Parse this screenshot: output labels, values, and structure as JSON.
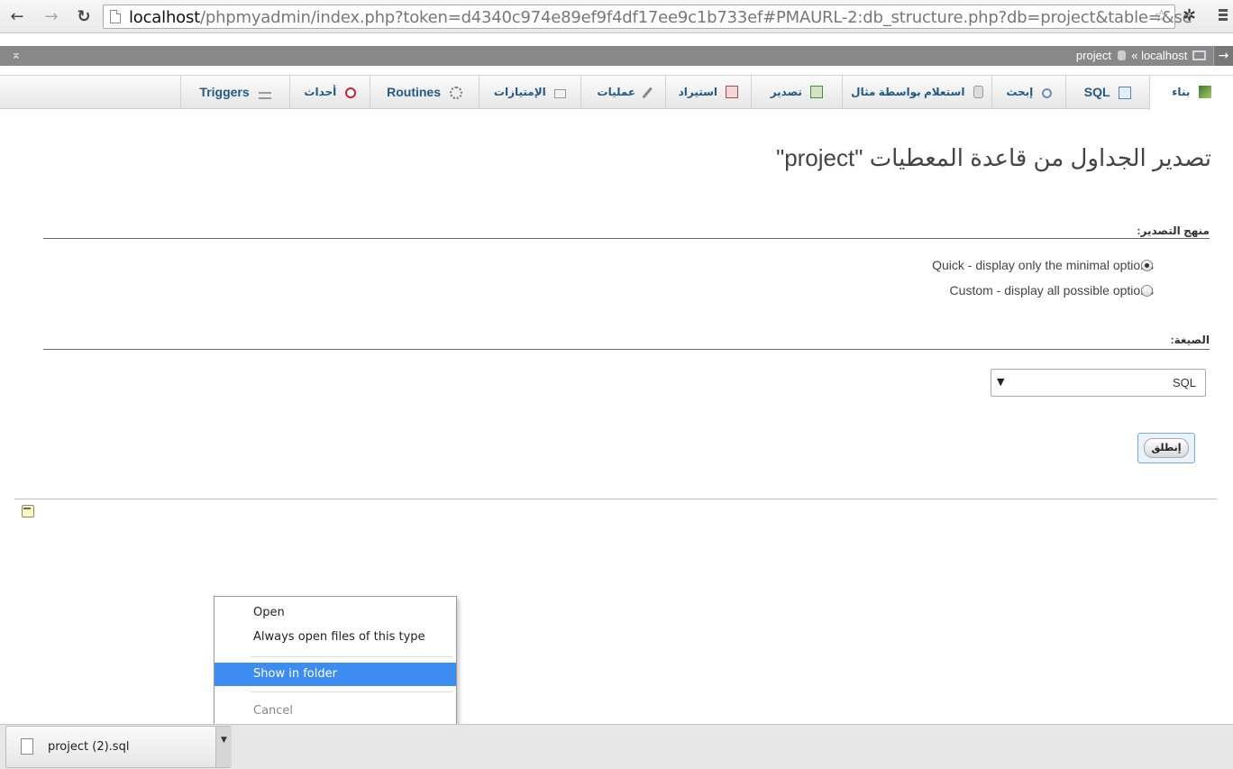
{
  "browser": {
    "url_host": "localhost",
    "url_rest": "/phpmyadmin/index.php?token=d4340c974e89ef9f4df17ee9c1b733ef#PMAURL-2:db_structure.php?db=project&table=&se"
  },
  "topbar": {
    "breadcrumb_db": "project",
    "breadcrumb_sep": "«",
    "breadcrumb_server": "localhost"
  },
  "tabs": [
    {
      "label": "بناء",
      "icon": "structure-icon",
      "active": true
    },
    {
      "label": "SQL",
      "icon": "sql-icon"
    },
    {
      "label": "إبحث",
      "icon": "search-icon"
    },
    {
      "label": "استعلام بواسطة مثال",
      "icon": "query-icon"
    },
    {
      "label": "تصدير",
      "icon": "export-icon"
    },
    {
      "label": "استيراد",
      "icon": "import-icon"
    },
    {
      "label": "عمليات",
      "icon": "operations-icon"
    },
    {
      "label": "الإمتيازات",
      "icon": "privileges-icon"
    },
    {
      "label": "Routines",
      "icon": "routines-icon"
    },
    {
      "label": "أحداث",
      "icon": "events-icon"
    },
    {
      "label": "Triggers",
      "icon": "triggers-icon"
    }
  ],
  "main": {
    "title": "تصدير الجداول من قاعدة المعطيات \"project\"",
    "method_label": "منهج التصدير:",
    "method_options": [
      {
        "label": "Quick - display only the minimal options",
        "checked": true
      },
      {
        "label": "Custom - display all possible options",
        "checked": false
      }
    ],
    "format_label": "الصيغة:",
    "format_value": "SQL",
    "go_label": "إنطلق"
  },
  "context_menu": {
    "items": [
      "Open",
      "Always open files of this type",
      "Show in folder",
      "Cancel"
    ],
    "highlighted": "Show in folder"
  },
  "download": {
    "filename": "project (2).sql"
  },
  "colors": {
    "accent": "#3c8cf2",
    "tab_text": "#235a81",
    "topbar": "#888888"
  }
}
